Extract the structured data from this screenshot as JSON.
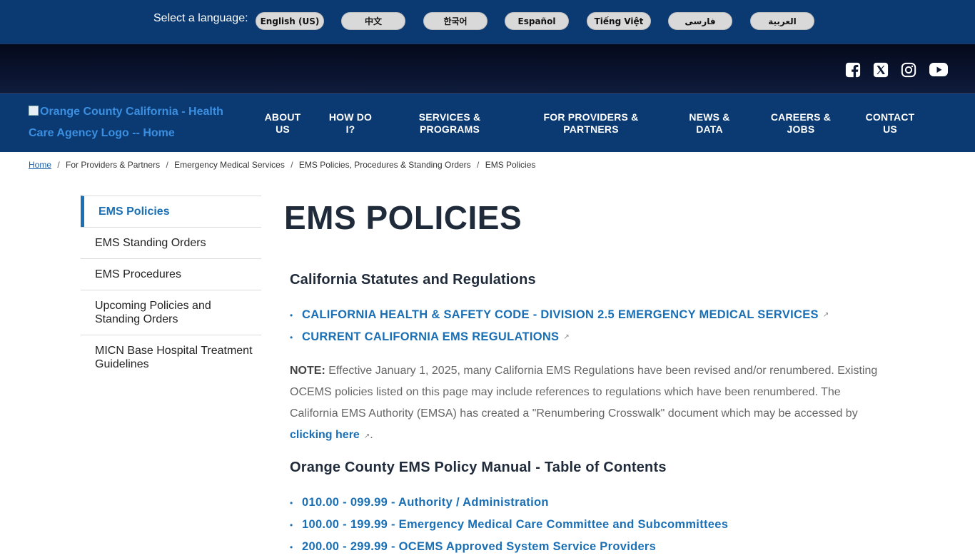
{
  "language_bar": {
    "label": "Select a language:",
    "languages": [
      "English (US)",
      "中文",
      "한국어",
      "Español",
      "Tiếng Việt",
      "فارسی",
      "العربية"
    ]
  },
  "social": {
    "icons": [
      "facebook-icon",
      "x-twitter-icon",
      "instagram-icon",
      "youtube-icon"
    ]
  },
  "header": {
    "logo_alt": "Orange County California - Health Care Agency Logo -- Home",
    "nav": [
      {
        "line1": "ABOUT",
        "line2": "US"
      },
      {
        "line1": "HOW DO",
        "line2": "I?"
      },
      {
        "line1": "SERVICES &",
        "line2": "PROGRAMS"
      },
      {
        "line1": "FOR PROVIDERS &",
        "line2": "PARTNERS"
      },
      {
        "line1": "NEWS &",
        "line2": "DATA"
      },
      {
        "line1": "CAREERS &",
        "line2": "JOBS"
      },
      {
        "line1": "CONTACT",
        "line2": "US"
      }
    ]
  },
  "breadcrumb": {
    "items": [
      "Home",
      "For Providers & Partners",
      "Emergency Medical Services",
      "EMS Policies, Procedures & Standing Orders",
      "EMS Policies"
    ]
  },
  "sidebar": {
    "items": [
      {
        "label": "EMS Policies"
      },
      {
        "label": "EMS Standing Orders"
      },
      {
        "label": "EMS Procedures"
      },
      {
        "label": "Upcoming Policies and Standing Orders"
      },
      {
        "label": "MICN Base Hospital Treatment Guidelines"
      }
    ]
  },
  "content": {
    "title": "EMS POLICIES",
    "section1": {
      "heading": "California Statutes and Regulations",
      "links": [
        "CALIFORNIA HEALTH & SAFETY CODE - DIVISION 2.5 EMERGENCY MEDICAL SERVICES",
        "CURRENT CALIFORNIA EMS REGULATIONS"
      ]
    },
    "note": {
      "label": "NOTE:",
      "text": " Effective January 1, 2025, many California EMS Regulations have been revised and/or renumbered. Existing OCEMS policies listed on this page may include references to regulations which have been renumbered.  The California EMS Authority (EMSA) has created a \"Renumbering Crosswalk\" document which may be accessed by ",
      "link": "clicking here",
      "end": "."
    },
    "section2": {
      "heading": "Orange County EMS Policy Manual - Table of Contents",
      "links": [
        "010.00 - 099.99 - Authority / Administration",
        "100.00 - 199.99 - Emergency Medical Care Committee and Subcommittees",
        "200.00 - 299.99 - OCEMS Approved System Service Providers"
      ]
    }
  },
  "colors": {
    "brand_navy": "#0b3a73",
    "link_blue": "#1a6fb5",
    "heading": "#1f2a3a"
  }
}
